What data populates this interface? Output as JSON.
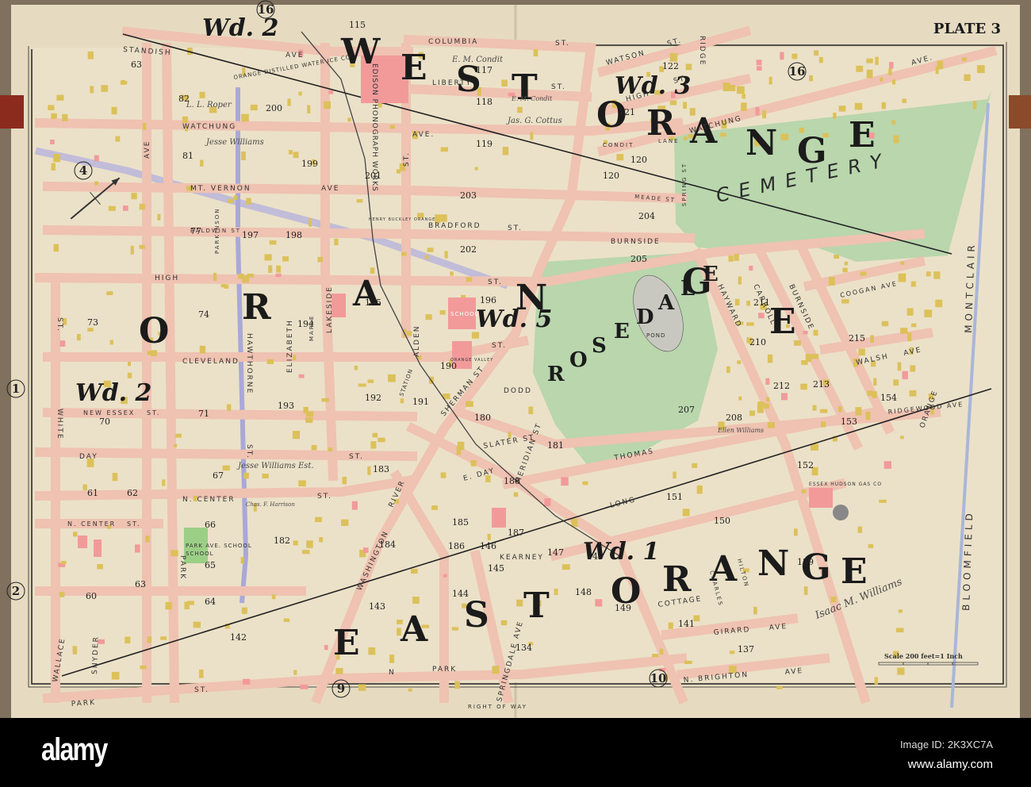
{
  "plate_title": "PLATE 3",
  "scale": {
    "label": "Scale 200 feet=1 Inch"
  },
  "colors": {
    "paper": "#e8dec5",
    "street": "#efc2b1",
    "park": "#b9d6ad",
    "building": "#dcc15a",
    "brick": "#f29a9a",
    "water": "#a9a8d8"
  },
  "towns": {
    "west_orange": [
      "W",
      "E",
      "S",
      "T",
      "O",
      "R",
      "A",
      "N",
      "G",
      "E"
    ],
    "orange": [
      "O",
      "R",
      "A",
      "N",
      "G",
      "E"
    ],
    "east_orange": [
      "E",
      "A",
      "S",
      "T",
      "O",
      "R",
      "A",
      "N",
      "G",
      "E"
    ],
    "rosedale": [
      "R",
      "O",
      "S",
      "E",
      "D",
      "A",
      "L",
      "E"
    ]
  },
  "wards": [
    "Wd. 2",
    "Wd. 3",
    "Wd. 2",
    "Wd. 5",
    "Wd. 1"
  ],
  "circled_plates": [
    "16",
    "16",
    "4",
    "1",
    "2",
    "9",
    "10"
  ],
  "streets": [
    "STANDISH",
    "AVE",
    "COLUMBIA",
    "ST.",
    "LIBERTY",
    "ST.",
    "WATSON",
    "ST.",
    "RIDGE",
    "HIGH",
    "ST.",
    "AVE.",
    "WATCHUNG",
    "AVE.",
    "WATCHUNG",
    "CONDIT",
    "LANE",
    "MT. VERNON",
    "AVE",
    "BALDWIN ST",
    "MEADE ST",
    "BRADFORD",
    "ST.",
    "BURNSIDE",
    "HIGH",
    "ST.",
    "CLEVELAND",
    "ST.",
    "NEW ESSEX",
    "ST.",
    "DAY",
    "ST.",
    "N. CENTER",
    "ST.",
    "N. CENTER",
    "ST.",
    "PARK",
    "ST.",
    "WALLACE",
    "SNYDER",
    "WHITE",
    "ST.",
    "PARK",
    "AVE",
    "HAWTHORNE",
    "ST.",
    "LAKESIDE",
    "ALDEN",
    "ST.",
    "WASHINGTON",
    "RIVER",
    "SHERMAN ST",
    "DODD",
    "SLATER ST",
    "MERIDIAN ST",
    "LONG",
    "THOMAS",
    "KEARNEY",
    "COTTAGE",
    "GIRARD",
    "AVE",
    "N. BRIGHTON",
    "AVE",
    "SPRINGDALE AVE",
    "RIGHT OF WAY",
    "PARK",
    "N",
    "CARROLL",
    "HAYWARD",
    "BURNSIDE",
    "COOGAN AVE",
    "WALSH",
    "AVE",
    "RIDGEWOOD AVE",
    "ORANGE",
    "BLOOMFIELD",
    "MONTCLAIR",
    "E. DAY",
    "CHARLES",
    "HILTON",
    "ELIZABETH",
    "SPRING ST",
    "PARKINSON",
    "MAPLE"
  ],
  "plate_numbers": [
    "115",
    "117",
    "118",
    "119",
    "120",
    "120",
    "121",
    "122",
    "82",
    "200",
    "81",
    "199",
    "201",
    "203",
    "204",
    "202",
    "205",
    "77",
    "197",
    "198",
    "73",
    "74",
    "194",
    "195",
    "196",
    "190",
    "70",
    "71",
    "193",
    "192",
    "191",
    "183",
    "180",
    "67",
    "66",
    "65",
    "64",
    "182",
    "184",
    "186",
    "187",
    "188",
    "181",
    "185",
    "143",
    "144",
    "146",
    "145",
    "147",
    "148",
    "149",
    "150",
    "151",
    "152",
    "153",
    "154",
    "207",
    "208",
    "210",
    "211",
    "212",
    "213",
    "215",
    "63",
    "62",
    "61",
    "60",
    "63",
    "142",
    "134",
    "137",
    "139",
    "141",
    "140"
  ],
  "institutions": [
    "ORANGE DISTILLED WATER ICE CO",
    "EDISON PHONOGRAPH WORKS",
    "SCHOOL",
    "PARK AVE. SCHOOL",
    "HENRY BUCKLEY ORANGE",
    "POND",
    "CEMETERY",
    "ESSEX HUDSON GAS CO",
    "STATION",
    "ORANGE VALLEY",
    "SCHOOL"
  ],
  "owners": [
    "Jesse Williams",
    "Jesse Williams Est.",
    "Isaac M. Williams",
    "L. L. Roper",
    "E. M. Condit",
    "Jas. G. Cottus",
    "Chas. F. Harrison",
    "Ellen Williams",
    "E. M. Condit"
  ],
  "footer": {
    "logo": "alamy",
    "image_id": "Image ID: 2K3XC7A",
    "url": "www.alamy.com"
  }
}
